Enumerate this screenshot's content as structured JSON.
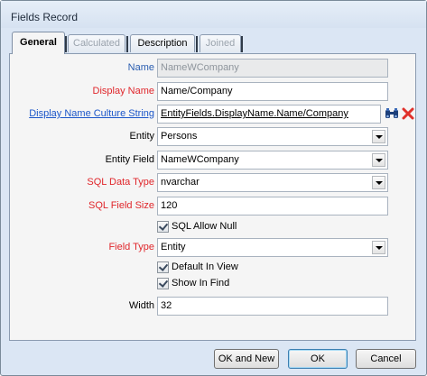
{
  "window": {
    "title": "Fields Record"
  },
  "tabs": [
    {
      "label": "General",
      "state": "active"
    },
    {
      "label": "Calculated",
      "state": "disabled"
    },
    {
      "label": "Description",
      "state": "enabled"
    },
    {
      "label": "Joined",
      "state": "disabled"
    }
  ],
  "form": {
    "name": {
      "label": "Name",
      "value": "NameWCompany"
    },
    "display_name": {
      "label": "Display Name",
      "value": "Name/Company"
    },
    "display_name_culture_string": {
      "label": "Display Name Culture String",
      "value": "EntityFields.DisplayName.Name/Company"
    },
    "entity": {
      "label": "Entity",
      "value": "Persons"
    },
    "entity_field": {
      "label": "Entity Field",
      "value": "NameWCompany"
    },
    "sql_data_type": {
      "label": "SQL Data Type",
      "value": "nvarchar"
    },
    "sql_field_size": {
      "label": "SQL Field Size",
      "value": "120"
    },
    "sql_allow_null": {
      "label": "SQL Allow Null",
      "checked": true
    },
    "field_type": {
      "label": "Field Type",
      "value": "Entity"
    },
    "default_in_view": {
      "label": "Default In View",
      "checked": true
    },
    "show_in_find": {
      "label": "Show In Find",
      "checked": true
    },
    "width": {
      "label": "Width",
      "value": "32"
    }
  },
  "buttons": {
    "ok_and_new": "OK and New",
    "ok": "OK",
    "cancel": "Cancel"
  },
  "colors": {
    "label_required": "#e0262b",
    "label_normal": "#2a5db0",
    "link": "#1b56c9"
  }
}
